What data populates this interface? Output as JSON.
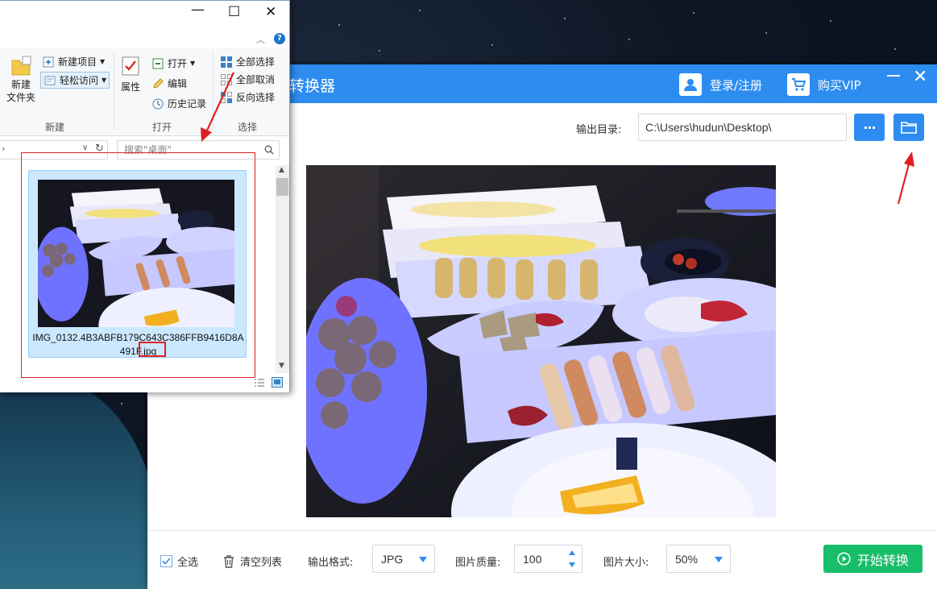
{
  "explorer": {
    "window_controls": {
      "minimize": "—",
      "maximize": "☐",
      "close": "✕"
    },
    "ribbon": {
      "new_folder": "新建\n文件夹",
      "new_item": "新建项目",
      "easy_access": "轻松访问",
      "properties": "属性",
      "open": "打开",
      "edit": "编辑",
      "history": "历史记录",
      "select_all": "全部选择",
      "select_none": "全部取消",
      "invert_selection": "反向选择",
      "groups": {
        "new": "新建",
        "open": "打开",
        "select": "选择"
      }
    },
    "search_placeholder": "搜索\"桌面\"",
    "file": {
      "name_main": "IMG_0132.4B3ABFB179C643C386FFB9416D8A491",
      "name_ext": "F.jpg"
    }
  },
  "app": {
    "title": "转换器",
    "login": "登录/注册",
    "vip": "购买VIP",
    "output_dir_label": "输出目录:",
    "output_dir_value": "C:\\Users\\hudun\\Desktop\\",
    "more_button": "···",
    "footer": {
      "select_all": "全选",
      "clear_list": "清空列表",
      "format_label": "输出格式:",
      "format_value": "JPG",
      "quality_label": "图片质量:",
      "quality_value": "100",
      "size_label": "图片大小:",
      "size_value": "50%",
      "start_button": "开始转换"
    }
  },
  "colors": {
    "accent_blue": "#2d8cf0",
    "start_green": "#19be6b",
    "annotation_red": "#e02020"
  }
}
